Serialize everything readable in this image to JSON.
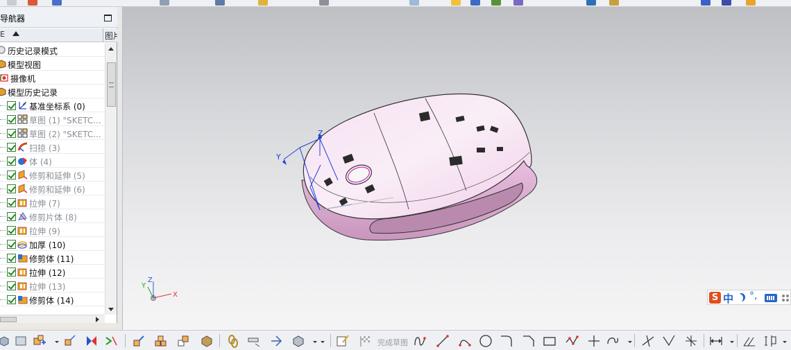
{
  "navigator": {
    "title": "导航器",
    "columns": {
      "name": "E",
      "image": "图片"
    },
    "rows": [
      {
        "label": "历史记录模式",
        "icon": "history-mode-icon",
        "indent": 0,
        "checked": false,
        "dim": false
      },
      {
        "label": "模型视图",
        "icon": "model-view-icon",
        "indent": 0,
        "checked": false,
        "dim": false
      },
      {
        "label": "摄像机",
        "icon": "camera-icon",
        "indent": 1,
        "checked": false,
        "dim": false
      },
      {
        "label": "模型历史记录",
        "icon": "model-history-icon",
        "indent": 0,
        "checked": false,
        "dim": false
      },
      {
        "label": "基准坐标系 (0)",
        "icon": "datum-csys-icon",
        "indent": 2,
        "checked": true,
        "dim": false
      },
      {
        "label": "草图 (1) \"SKETC...",
        "icon": "sketch-icon",
        "indent": 2,
        "checked": true,
        "dim": true
      },
      {
        "label": "草图 (2) \"SKETC...",
        "icon": "sketch-icon",
        "indent": 2,
        "checked": true,
        "dim": true
      },
      {
        "label": "扫掠 (3)",
        "icon": "sweep-icon",
        "indent": 2,
        "checked": true,
        "dim": true
      },
      {
        "label": "体 (4)",
        "icon": "body-icon",
        "indent": 2,
        "checked": true,
        "dim": true
      },
      {
        "label": "修剪和延伸 (5)",
        "icon": "trim-extend-icon",
        "indent": 2,
        "checked": true,
        "dim": true
      },
      {
        "label": "修剪和延伸 (6)",
        "icon": "trim-extend-icon",
        "indent": 2,
        "checked": true,
        "dim": true
      },
      {
        "label": "拉伸 (7)",
        "icon": "extrude-icon",
        "indent": 2,
        "checked": true,
        "dim": true
      },
      {
        "label": "修剪片体 (8)",
        "icon": "trim-sheet-icon",
        "indent": 2,
        "checked": true,
        "dim": true
      },
      {
        "label": "拉伸 (9)",
        "icon": "extrude-icon",
        "indent": 2,
        "checked": true,
        "dim": true
      },
      {
        "label": "加厚 (10)",
        "icon": "thicken-icon",
        "indent": 2,
        "checked": true,
        "dim": false
      },
      {
        "label": "修剪体 (11)",
        "icon": "trim-body-icon",
        "indent": 2,
        "checked": true,
        "dim": false
      },
      {
        "label": "拉伸 (12)",
        "icon": "extrude-icon",
        "indent": 2,
        "checked": true,
        "dim": false
      },
      {
        "label": "拉伸 (13)",
        "icon": "extrude-icon",
        "indent": 2,
        "checked": true,
        "dim": true
      },
      {
        "label": "修剪体 (14)",
        "icon": "trim-body-icon",
        "indent": 2,
        "checked": true,
        "dim": false
      }
    ]
  },
  "viewport": {
    "csys_labels": {
      "x": "X",
      "y": "Y",
      "z": "Z"
    },
    "triad_labels": {
      "x": "X",
      "y": "Y",
      "z": "Z"
    },
    "model_color": "#f3d6ec"
  },
  "ime": {
    "logo": "S",
    "lang": "中",
    "punct": "°,"
  },
  "bottom_toolbar": {
    "finish_sketch": "完成草图"
  },
  "colors": {
    "accent": "#2766c9",
    "check": "#1a8a1a",
    "viewport_top": "#bfc0c4",
    "viewport_bottom": "#f5f5f6"
  }
}
